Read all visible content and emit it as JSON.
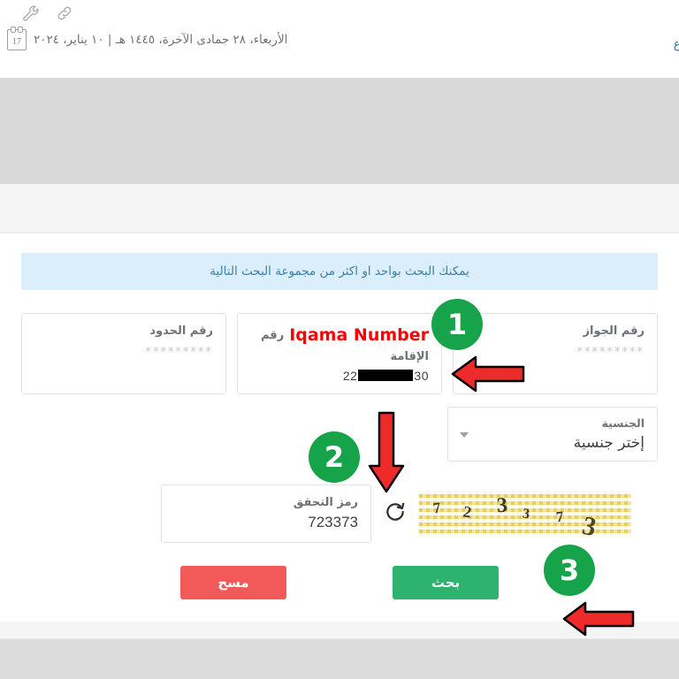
{
  "topbar": {
    "icons": [
      {
        "name": "wrench-icon",
        "glyph": "wrench"
      },
      {
        "name": "link-icon",
        "glyph": "chain-link"
      }
    ],
    "calendar_day": "17",
    "date_text": "الأربعاء، ٢٨ جمادى الآخرة، ١٤٤٥ هـ | ١٠ يناير، ٢٠٢٤",
    "right_clipped_text": "ع"
  },
  "hero": {
    "placeholder_color": "#d9d9d9"
  },
  "form": {
    "info_banner": "يمكنك البحث بواحد او اكثر من مجموعة البحث التالية",
    "fields": [
      {
        "id": "border-number",
        "label": "رقم الحدود",
        "value": "",
        "placeholder": "*********"
      },
      {
        "id": "iqama-number",
        "label": "رقم الإقامة",
        "annotation_en": "Iqama Number",
        "value_prefix": "22",
        "value_suffix": "30",
        "value_redacted": true,
        "placeholder": ""
      },
      {
        "id": "passport-number",
        "label": "رقم الجواز",
        "value": "",
        "placeholder": "*********"
      }
    ],
    "nationality": {
      "label": "الجنسية",
      "selected": "إختر جنسية"
    },
    "captcha": {
      "code_label": "رمز التحقق",
      "code_value": "723373",
      "image_digits": [
        "7",
        "2",
        "3",
        "3",
        "7",
        "3"
      ],
      "refresh_icon": "refresh-icon"
    },
    "buttons": {
      "search": "بحث",
      "clear": "مسح"
    }
  },
  "annotations": {
    "badges": [
      {
        "number": "1"
      },
      {
        "number": "2"
      },
      {
        "number": "3"
      }
    ],
    "arrow_color": "#ee2b2b",
    "badge_color": "#16a34a"
  },
  "colors": {
    "info_banner_bg": "#dbeefb",
    "info_banner_text": "#3f7fa8",
    "search_button": "#2eb26f",
    "clear_button": "#f25a5a",
    "annotation_red": "#ff0000",
    "page_bg": "#f5f5f5"
  }
}
